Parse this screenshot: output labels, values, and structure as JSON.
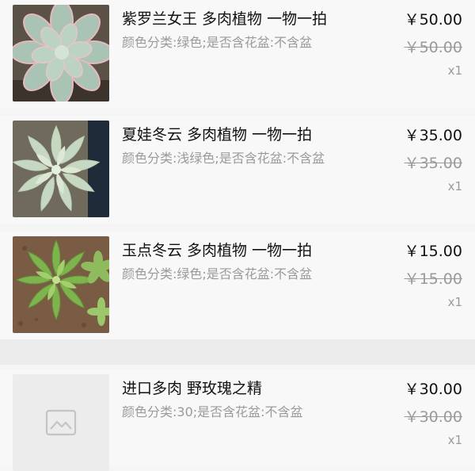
{
  "orders": [
    {
      "title": "紫罗兰女王 多肉植物 一物一拍",
      "attrs": "颜色分类:绿色;是否含花盆:不含盆",
      "price": "￥50.00",
      "original_price": "￥50.00",
      "qty": "x1",
      "image": "succulent-photo"
    },
    {
      "title": "夏娃冬云 多肉植物 一物一拍",
      "attrs": "颜色分类:浅绿色;是否含花盆:不含盆",
      "price": "￥35.00",
      "original_price": "￥35.00",
      "qty": "x1",
      "image": "succulent-photo"
    },
    {
      "title": "玉点冬云 多肉植物 一物一拍",
      "attrs": "颜色分类:绿色;是否含花盆:不含盆",
      "price": "￥15.00",
      "original_price": "￥15.00",
      "qty": "x1",
      "image": "succulent-photo"
    },
    {
      "title": "进口多肉 野玫瑰之精",
      "attrs": "颜色分类:30;是否含花盆:不含盆",
      "price": "￥30.00",
      "original_price": "￥30.00",
      "qty": "x1",
      "image": "image-placeholder-icon"
    }
  ],
  "colors": {
    "title_text": "#111111",
    "secondary_text": "#9a9a9a",
    "card_background": "#f8f8f8",
    "page_background": "#f5f5f5"
  }
}
